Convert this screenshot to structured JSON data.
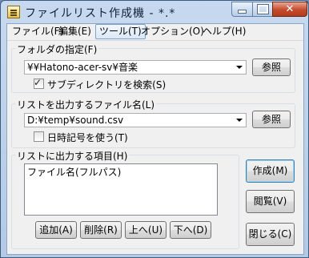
{
  "window": {
    "title": "ファイルリスト作成機 - *.*"
  },
  "menu": [
    {
      "label": "ファイル(F)"
    },
    {
      "label": "編集(E)"
    },
    {
      "label": "ツール(T)"
    },
    {
      "label": "オプション(O)"
    },
    {
      "label": "ヘルプ(H)"
    }
  ],
  "folder": {
    "label": "フォルダの指定(F)",
    "value": "¥¥Hatono-acer-sv¥音楽",
    "browse_label": "参照",
    "subdir_label": "サブディレクトリを検索(S)",
    "subdir_checked": true
  },
  "output": {
    "label": "リストを出力するファイル名(L)",
    "value": "D:¥temp¥sound.csv",
    "browse_label": "参照",
    "timestamp_label": "日時記号を使う(T)",
    "timestamp_checked": false
  },
  "items": {
    "label": "リストに出力する項目(H)",
    "list": [
      "ファイル名(フルパス)"
    ],
    "add_label": "追加(A)",
    "delete_label": "削除(R)",
    "up_label": "上へ(U)",
    "down_label": "下へ(D)"
  },
  "actions": {
    "create_label": "作成(M)",
    "view_label": "閲覧(V)",
    "close_label": "閉じる(C)"
  }
}
